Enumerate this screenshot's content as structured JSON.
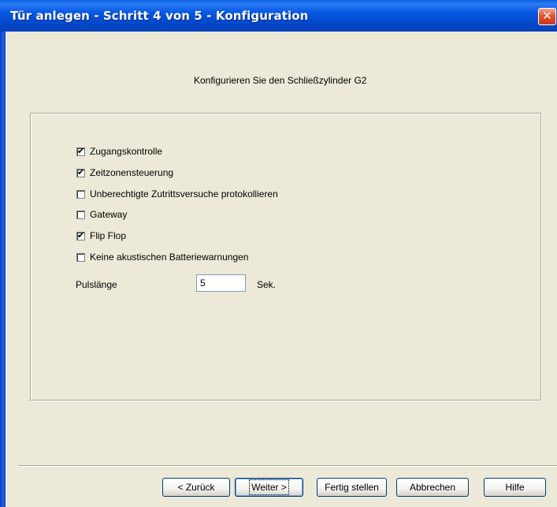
{
  "window": {
    "title": "Tür anlegen - Schritt 4 von 5 - Konfiguration",
    "close_glyph": "✕"
  },
  "heading": "Konfigurieren Sie den Schließzylinder G2",
  "options": [
    {
      "label": "Zugangskontrolle",
      "checked": true
    },
    {
      "label": "Zeitzonensteuerung",
      "checked": true
    },
    {
      "label": "Unberechtigte Zutrittsversuche protokollieren",
      "checked": false
    },
    {
      "label": "Gateway",
      "checked": false
    },
    {
      "label": "Flip Flop",
      "checked": true
    },
    {
      "label": "Keine akustischen Batteriewarnungen",
      "checked": false
    }
  ],
  "pulse": {
    "label": "Pulslänge",
    "value": "5",
    "unit": "Sek."
  },
  "buttons": {
    "back": "< Zurück",
    "next": "Weiter >",
    "finish": "Fertig stellen",
    "cancel": "Abbrechen",
    "help": "Hilfe"
  },
  "check_glyph": "✔"
}
